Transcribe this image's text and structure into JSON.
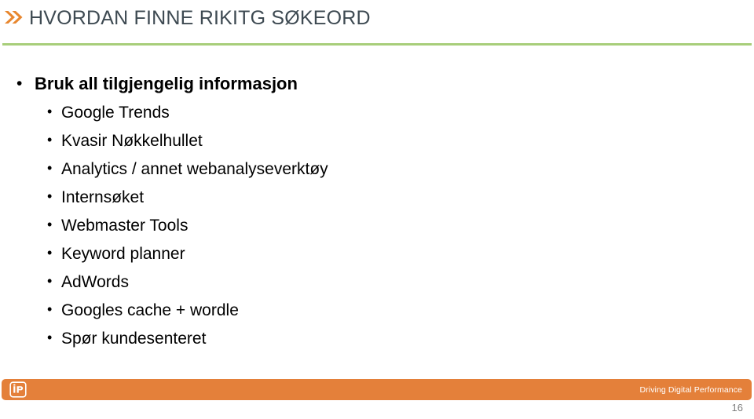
{
  "slide": {
    "title": "HVORDAN FINNE RIKITG SØKEORD",
    "title_icon": "double-chevron-right-icon",
    "accent_orange": "#E4803A",
    "accent_green": "#A8CE7A",
    "title_color": "#3E4A52",
    "bullet_char": "•",
    "bullets": [
      {
        "level": 1,
        "text": "Bruk all tilgjengelig informasjon"
      },
      {
        "level": 2,
        "text": "Google Trends"
      },
      {
        "level": 2,
        "text": "Kvasir Nøkkelhullet"
      },
      {
        "level": 2,
        "text": "Analytics / annet webanalyseverktøy"
      },
      {
        "level": 2,
        "text": "Internsøket"
      },
      {
        "level": 2,
        "text": "Webmaster Tools"
      },
      {
        "level": 2,
        "text": "Keyword planner"
      },
      {
        "level": 2,
        "text": "AdWords"
      },
      {
        "level": 2,
        "text": "Googles cache + wordle"
      },
      {
        "level": 2,
        "text": "Spør kundesenteret"
      }
    ],
    "footer": {
      "logo_icon": "ip-logo-icon",
      "tagline": "Driving Digital Performance",
      "slide_number": "16"
    }
  }
}
